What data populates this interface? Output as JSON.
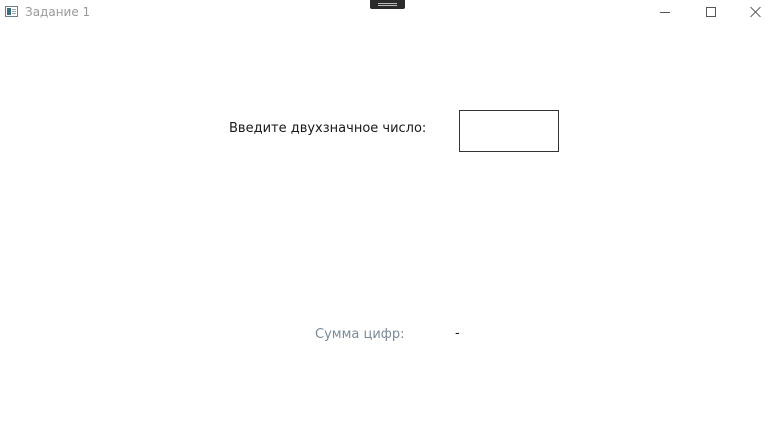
{
  "window": {
    "title": "Задание 1",
    "icon": "app-window-icon",
    "controls": {
      "minimize_icon": "minimize-icon",
      "maximize_icon": "maximize-icon",
      "close_icon": "close-icon"
    }
  },
  "form": {
    "prompt_label": "Введите двухзначное число:",
    "number_input": {
      "value": "",
      "placeholder": ""
    }
  },
  "result": {
    "label": "Сумма цифр:",
    "value": "-"
  },
  "colors": {
    "background": "#ffffff",
    "label_text": "#1a1a1a",
    "result_label": "#7a8a99",
    "input_border": "#333333"
  }
}
